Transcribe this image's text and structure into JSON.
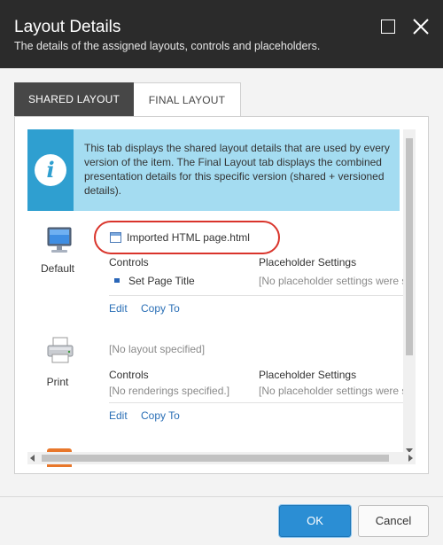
{
  "dialog": {
    "title": "Layout Details",
    "subtitle": "The details of the assigned layouts, controls and placeholders."
  },
  "tabs": [
    {
      "label": "SHARED LAYOUT",
      "active": true
    },
    {
      "label": "FINAL LAYOUT",
      "active": false
    }
  ],
  "info": {
    "icon": "info-icon",
    "text": "This tab displays the shared layout details that are used by every version of the item. The Final Layout tab displays the combined presentation details for this specific version (shared + versioned details)."
  },
  "devices": [
    {
      "label": "Default",
      "icon": "monitor-icon",
      "layout": "Imported HTML page.html",
      "controls_header": "Controls",
      "placeholder_header": "Placeholder Settings",
      "rendering": "Set Page Title",
      "placeholder_value": "[No placeholder settings were specified.]",
      "edit_label": "Edit",
      "copy_label": "Copy To"
    },
    {
      "label": "Print",
      "icon": "printer-icon",
      "layout": "[No layout specified]",
      "controls_header": "Controls",
      "placeholder_header": "Placeholder Settings",
      "rendering": "[No renderings specified.]",
      "placeholder_value": "[No placeholder settings were specified.]",
      "edit_label": "Edit",
      "copy_label": "Copy To"
    }
  ],
  "footer": {
    "ok_label": "OK",
    "cancel_label": "Cancel"
  },
  "colors": {
    "titlebar": "#2b2b2b",
    "info_bg": "#a4dcf1",
    "info_icon_bg": "#2f9fd0",
    "link": "#2a6fb6",
    "highlight": "#d9342b",
    "ok_button": "#2b8ed4"
  }
}
